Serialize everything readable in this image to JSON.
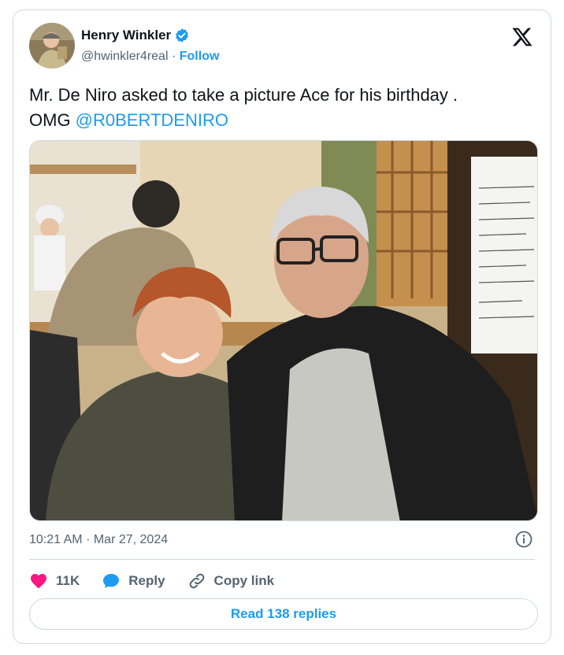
{
  "author": {
    "name": "Henry Winkler",
    "handle": "@hwinkler4real",
    "separator": "·",
    "follow_label": "Follow",
    "verified": true
  },
  "tweet": {
    "text_line1": "Mr. De Niro asked to take a picture Ace for his birthday .",
    "text_prefix": "OMG ",
    "mention": "@R0BERTDENIRO"
  },
  "photo": {
    "description_icon": "photo"
  },
  "meta": {
    "time": "10:21 AM",
    "separator": "·",
    "date": "Mar 27, 2024"
  },
  "actions": {
    "likes": "11K",
    "reply_label": "Reply",
    "copy_label": "Copy link"
  },
  "read_replies_label": "Read 138 replies",
  "colors": {
    "accent": "#1d9bf0",
    "like": "#f91880",
    "muted": "#536471",
    "border": "#cfd9de"
  }
}
